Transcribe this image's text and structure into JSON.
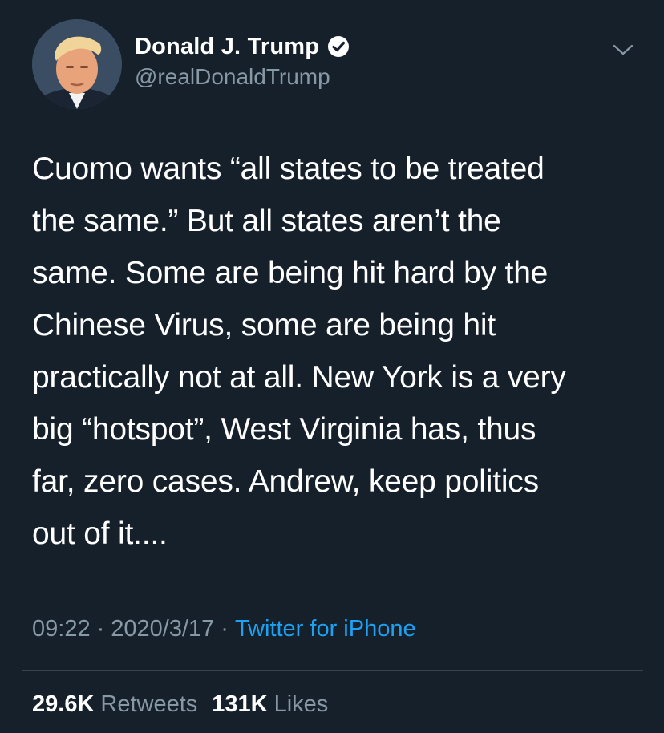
{
  "author": {
    "display_name": "Donald J. Trump",
    "handle": "@realDonaldTrump",
    "verified_icon": "verified-badge-icon"
  },
  "tweet": {
    "text": "Cuomo wants “all states to be treated\nthe same.” But all states aren’t the\nsame. Some are being hit hard by the\nChinese Virus, some are being hit\npractically not at all. New York is a very\nbig “hotspot”, West Virginia has, thus\nfar, zero cases. Andrew, keep politics\nout of it...."
  },
  "meta": {
    "time": "09:22",
    "separator": "·",
    "date": "2020/3/17",
    "source": "Twitter for iPhone"
  },
  "stats": {
    "retweets_count": "29.6K",
    "retweets_label": "Retweets",
    "likes_count": "131K",
    "likes_label": "Likes"
  },
  "colors": {
    "background": "#15202b",
    "text_primary": "#ffffff",
    "text_secondary": "#8899a6",
    "accent": "#1da1f2",
    "divider": "#38444d"
  },
  "icons": {
    "menu": "chevron-down-icon",
    "verified": "verified-badge-icon"
  }
}
